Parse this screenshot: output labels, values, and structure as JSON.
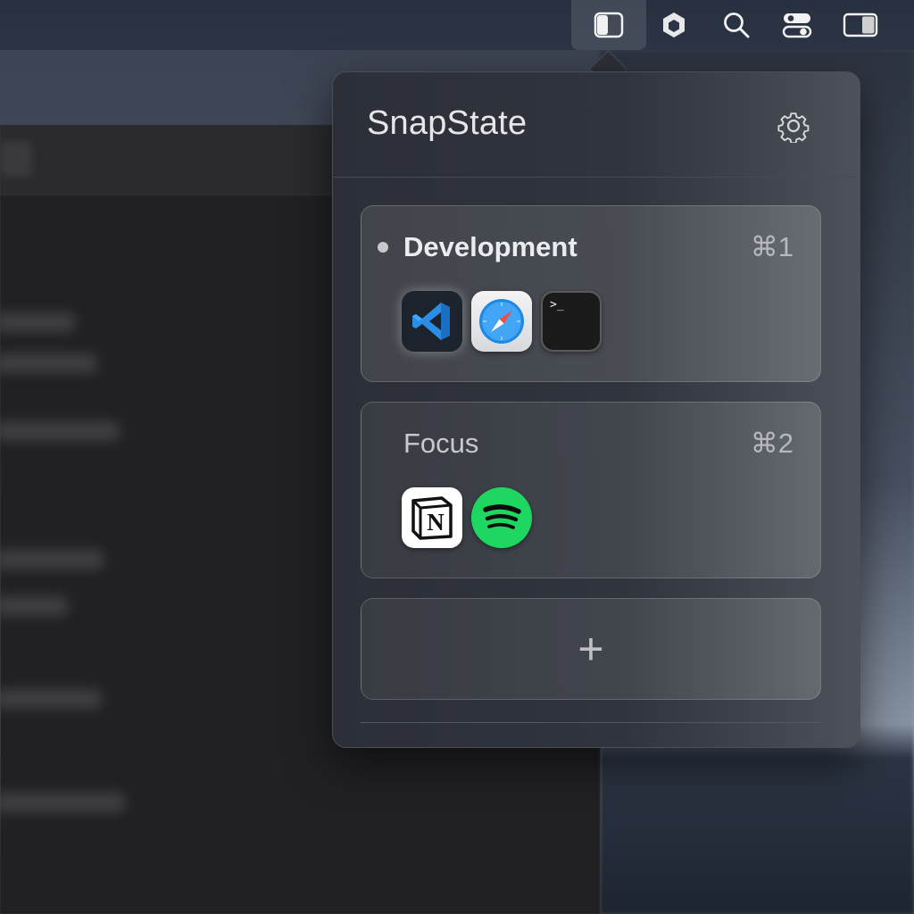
{
  "menubar": {
    "icons": [
      "snapstate-icon",
      "app-shield-icon",
      "search-icon",
      "control-center-icon",
      "sidebar-toggle-icon"
    ],
    "active": "snapstate-icon"
  },
  "popover": {
    "title": "SnapState",
    "settings_icon": "gear-icon",
    "workspaces": [
      {
        "name": "Development",
        "shortcut": "⌘1",
        "active": true,
        "apps": [
          "vscode-icon",
          "safari-icon",
          "terminal-icon"
        ],
        "terminal_prompt": ">_"
      },
      {
        "name": "Focus",
        "shortcut": "⌘2",
        "active": false,
        "apps": [
          "notion-icon",
          "spotify-icon"
        ],
        "notion_letter": "N"
      }
    ],
    "add_label": "+"
  },
  "colors": {
    "spotify_green": "#1ed760",
    "vscode_blue": "#2a8ee6",
    "safari_blue": "#1e88e5"
  }
}
